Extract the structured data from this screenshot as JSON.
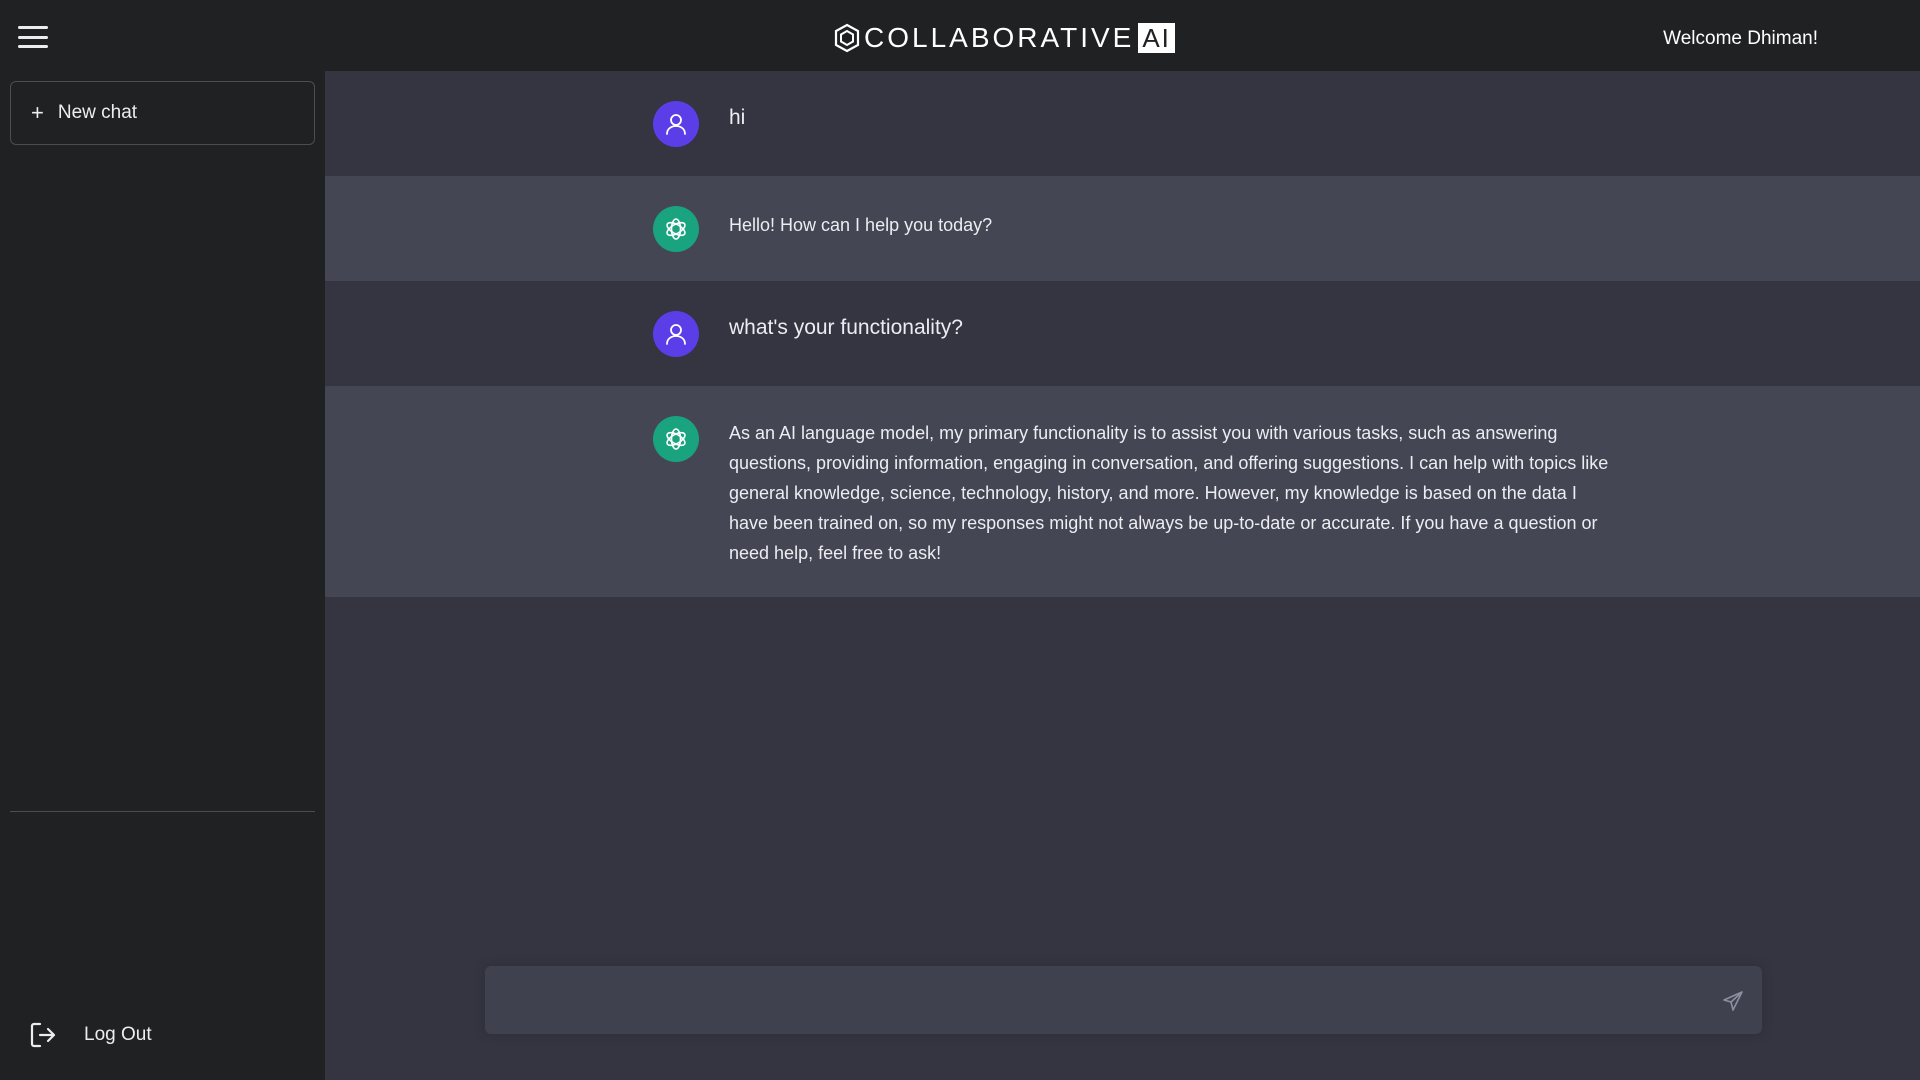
{
  "header": {
    "brand_name": "COLLABORATIVE",
    "brand_suffix": "AI",
    "welcome_text": "Welcome Dhiman!"
  },
  "sidebar": {
    "new_chat_label": "New chat",
    "logout_label": "Log Out"
  },
  "conversation": [
    {
      "role": "user",
      "text": "hi"
    },
    {
      "role": "assistant",
      "text": "Hello! How can I help you today?"
    },
    {
      "role": "user",
      "text": "what's your functionality?"
    },
    {
      "role": "assistant",
      "text": "As an AI language model, my primary functionality is to assist you with various tasks, such as answering questions, providing information, engaging in conversation, and offering suggestions. I can help with topics like general knowledge, science, technology, history, and more. However, my knowledge is based on the data I have been trained on, so my responses might not always be up-to-date or accurate. If you have a question or need help, feel free to ask!"
    }
  ],
  "composer": {
    "value": "",
    "placeholder": ""
  },
  "icons": {
    "menu": "hamburger-menu-icon",
    "brand_logo": "hexagon-logo-icon",
    "plus": "plus-icon",
    "user_avatar": "user-icon",
    "assistant_avatar": "openai-knot-icon",
    "send": "paper-plane-icon",
    "logout": "logout-arrow-icon"
  },
  "colors": {
    "sidebar_bg": "#202123",
    "main_bg": "#343541",
    "assistant_row_bg": "#444654",
    "user_avatar": "#5b3ee8",
    "assistant_avatar": "#19a37f",
    "composer_bg": "#40414f"
  }
}
